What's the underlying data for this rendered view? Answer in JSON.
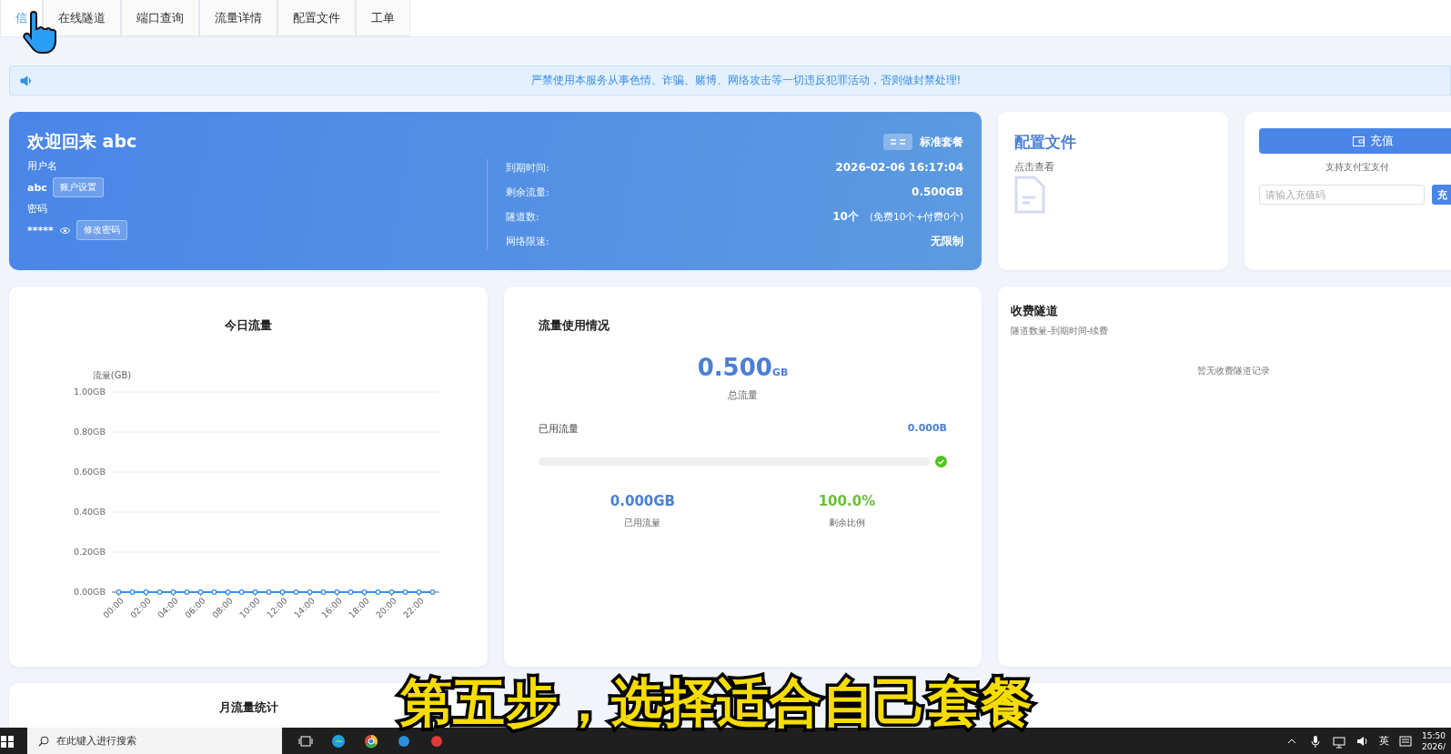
{
  "tabs": [
    {
      "label": "信",
      "selected": true
    },
    {
      "label": "在线隧道",
      "selected": false
    },
    {
      "label": "端口查询",
      "selected": false
    },
    {
      "label": "流量详情",
      "selected": false
    },
    {
      "label": "配置文件",
      "selected": false
    },
    {
      "label": "工单",
      "selected": false
    }
  ],
  "notice": {
    "text": "严禁使用本服务从事色情、诈骗、赌博、网络攻击等一切违反犯罪活动，否则做封禁处理!"
  },
  "welcome": {
    "title": "欢迎回来 abc",
    "plan": "标准套餐",
    "username_label": "用户名",
    "username": "abc",
    "account_button": "账户设置",
    "password_label": "密码",
    "password": "*****",
    "change_password_button": "修改密码",
    "details": [
      {
        "label": "到期时间:",
        "value": "2026-02-06 16:17:04"
      },
      {
        "label": "剩余流量:",
        "value": "0.500GB"
      },
      {
        "label": "隧道数:",
        "value": "10个",
        "note": "(免费10个+付费0个)"
      },
      {
        "label": "网络限速:",
        "value": "无限制"
      }
    ]
  },
  "config_card": {
    "title": "配置文件",
    "hint": "点击查看"
  },
  "recharge": {
    "button": "充值",
    "note": "支持支付宝支付",
    "placeholder": "请输入充值码",
    "submit": "充"
  },
  "today_traffic": {
    "title": "今日流量",
    "chart_data": {
      "type": "line",
      "ylabel": "流量(GB)",
      "x": [
        0,
        1,
        2,
        3,
        4,
        5,
        6,
        7,
        8,
        9,
        10,
        11,
        12,
        13,
        14,
        15,
        16,
        17,
        18,
        19,
        20,
        21,
        22,
        23
      ],
      "series": [
        {
          "color": "#3a8ee6",
          "marker": "circle",
          "values": [
            0,
            0,
            0,
            0,
            0,
            0,
            0,
            0,
            0,
            0,
            0,
            0,
            0,
            0,
            0,
            0,
            0,
            0,
            0,
            0,
            0,
            0,
            0,
            0
          ]
        }
      ],
      "xlim": [
        -0.5,
        23.5
      ],
      "ylim": [
        0,
        1
      ],
      "grid": true,
      "yticks": [
        {
          "value": 0,
          "label": "0.00GB"
        },
        {
          "value": 0.2,
          "label": "0.20GB"
        },
        {
          "value": 0.4,
          "label": "0.40GB"
        },
        {
          "value": 0.6,
          "label": "0.60GB"
        },
        {
          "value": 0.8,
          "label": "0.80GB"
        },
        {
          "value": 1,
          "label": "1.00GB"
        }
      ],
      "xticks": [
        {
          "value": 0,
          "label": "00:00"
        },
        {
          "value": 2,
          "label": "02:00"
        },
        {
          "value": 4,
          "label": "04:00"
        },
        {
          "value": 6,
          "label": "06:00"
        },
        {
          "value": 8,
          "label": "08:00"
        },
        {
          "value": 10,
          "label": "10:00"
        },
        {
          "value": 12,
          "label": "12:00"
        },
        {
          "value": 14,
          "label": "14:00"
        },
        {
          "value": 16,
          "label": "16:00"
        },
        {
          "value": 18,
          "label": "18:00"
        },
        {
          "value": 20,
          "label": "20:00"
        },
        {
          "value": 22,
          "label": "22:00"
        }
      ]
    }
  },
  "usage": {
    "title": "流量使用情况",
    "total": "0.500",
    "total_unit": "GB",
    "total_label": "总流量",
    "used_label": "已用流量",
    "used_value": "0.000B",
    "level": 0,
    "stats": [
      {
        "value": "0.000GB",
        "label": "已用流量",
        "color": "#4a7fd4"
      },
      {
        "value": "100.0%",
        "label": "剩余比例",
        "color": "#67c23a"
      }
    ]
  },
  "paid_tunnels": {
    "title": "收费隧道",
    "subtitle": "隧道数量-到期时间-续费",
    "empty": "暂无收费隧道记录"
  },
  "monthly": {
    "title": "月流量统计"
  },
  "caption": "第五步，选择适合自己套餐",
  "taskbar": {
    "search_placeholder": "在此键入进行搜索",
    "ime": "英",
    "time": "15:50",
    "date": "2026/"
  }
}
